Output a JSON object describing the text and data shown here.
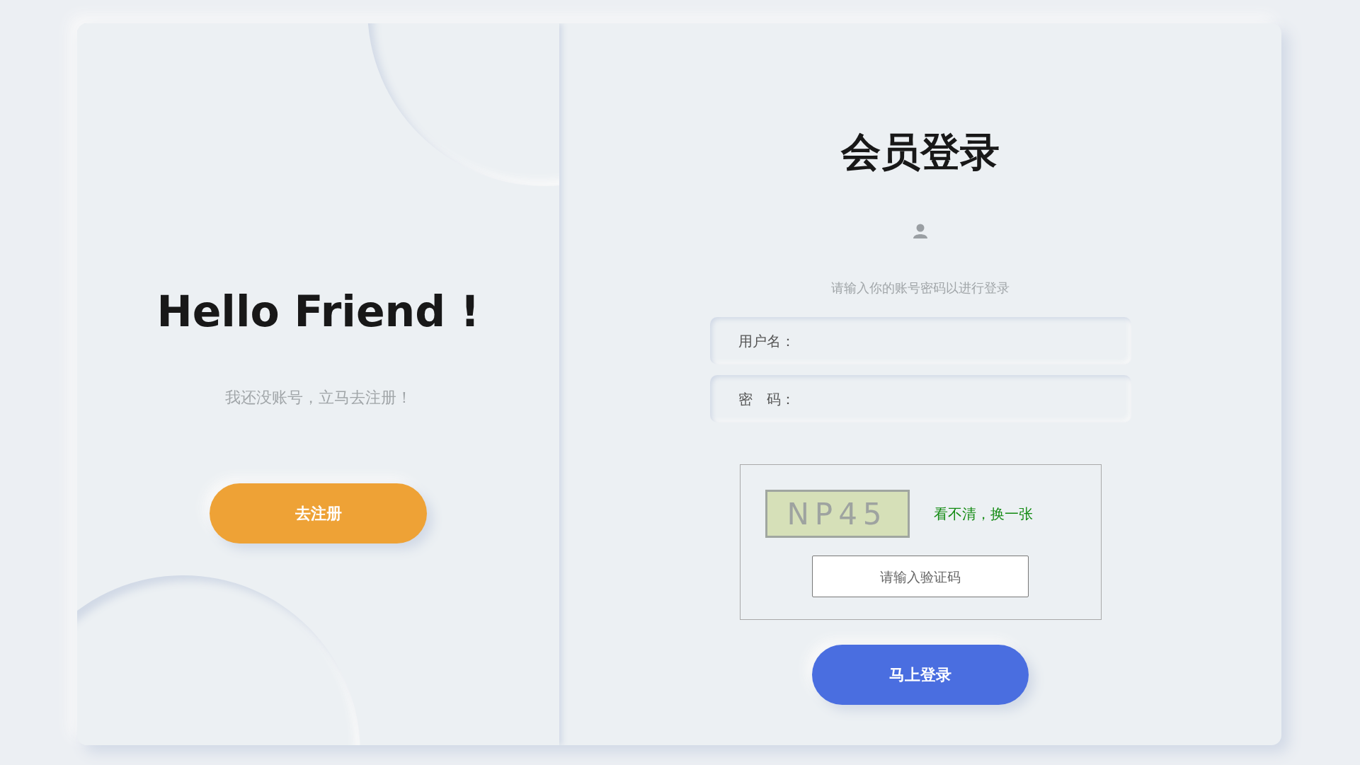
{
  "welcome": {
    "heading": "Hello Friend !",
    "text": "我还没账号，立马去注册！",
    "button": "去注册"
  },
  "login": {
    "title": "会员登录",
    "subtitle": "请输入你的账号密码以进行登录",
    "fields": [
      {
        "placeholder": "用户名："
      },
      {
        "placeholder": "密　码："
      }
    ],
    "captcha": {
      "code": "NP45",
      "refresh_link": "看不清，换一张",
      "placeholder": "请输入验证码"
    },
    "button": "马上登录"
  }
}
